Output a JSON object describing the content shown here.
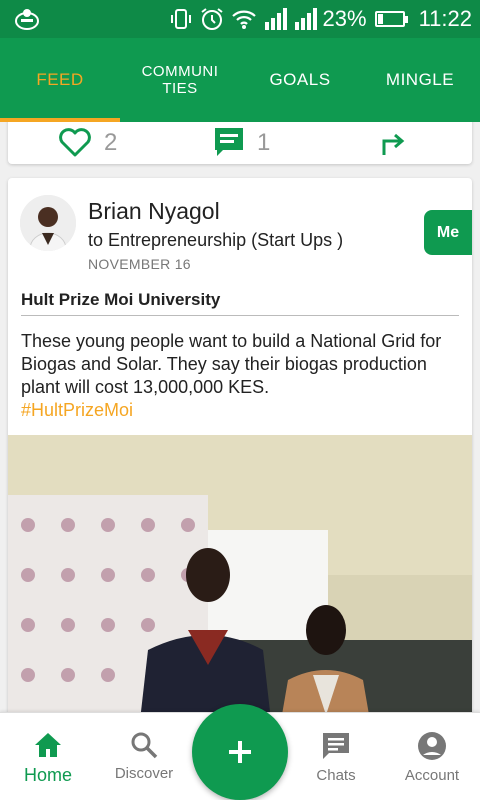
{
  "status_bar": {
    "battery": "23%",
    "battery_level": 0.23,
    "time": "11:22",
    "icons": [
      "app-logo-icon",
      "vibrate-icon",
      "alarm-icon",
      "wifi-icon",
      "signal-icon",
      "signal-icon",
      "battery-icon"
    ]
  },
  "tabs": [
    {
      "label": "FEED",
      "active": true
    },
    {
      "label": "COMMUNI\nTIES",
      "active": false
    },
    {
      "label": "GOALS",
      "active": false
    },
    {
      "label": "MINGLE",
      "active": false
    }
  ],
  "prev_card": {
    "likes": "2",
    "comments": "1",
    "icons": [
      "heart-icon",
      "comment-icon",
      "share-icon"
    ]
  },
  "post": {
    "author": "Brian Nyagol",
    "community": "to Entrepreneurship (Start Ups )",
    "date": "NOVEMBER 16",
    "me_label": "Me",
    "title": "Hult Prize Moi University",
    "body": "These young people want to build a National Grid for Biogas and Solar. They say their biogas production plant will cost 13,000,000 KES.",
    "hashtag": "#HultPrizeMoi"
  },
  "bottom_nav": [
    {
      "label": "Home",
      "icon": "home-icon",
      "active": true
    },
    {
      "label": "Discover",
      "icon": "search-icon",
      "active": false
    },
    {
      "label": "Chats",
      "icon": "chat-icon",
      "active": false
    },
    {
      "label": "Account",
      "icon": "account-icon",
      "active": false
    }
  ],
  "fab": {
    "icon": "plus-icon"
  },
  "colors": {
    "primary": "#0f9a50",
    "accent": "#f5a623"
  }
}
